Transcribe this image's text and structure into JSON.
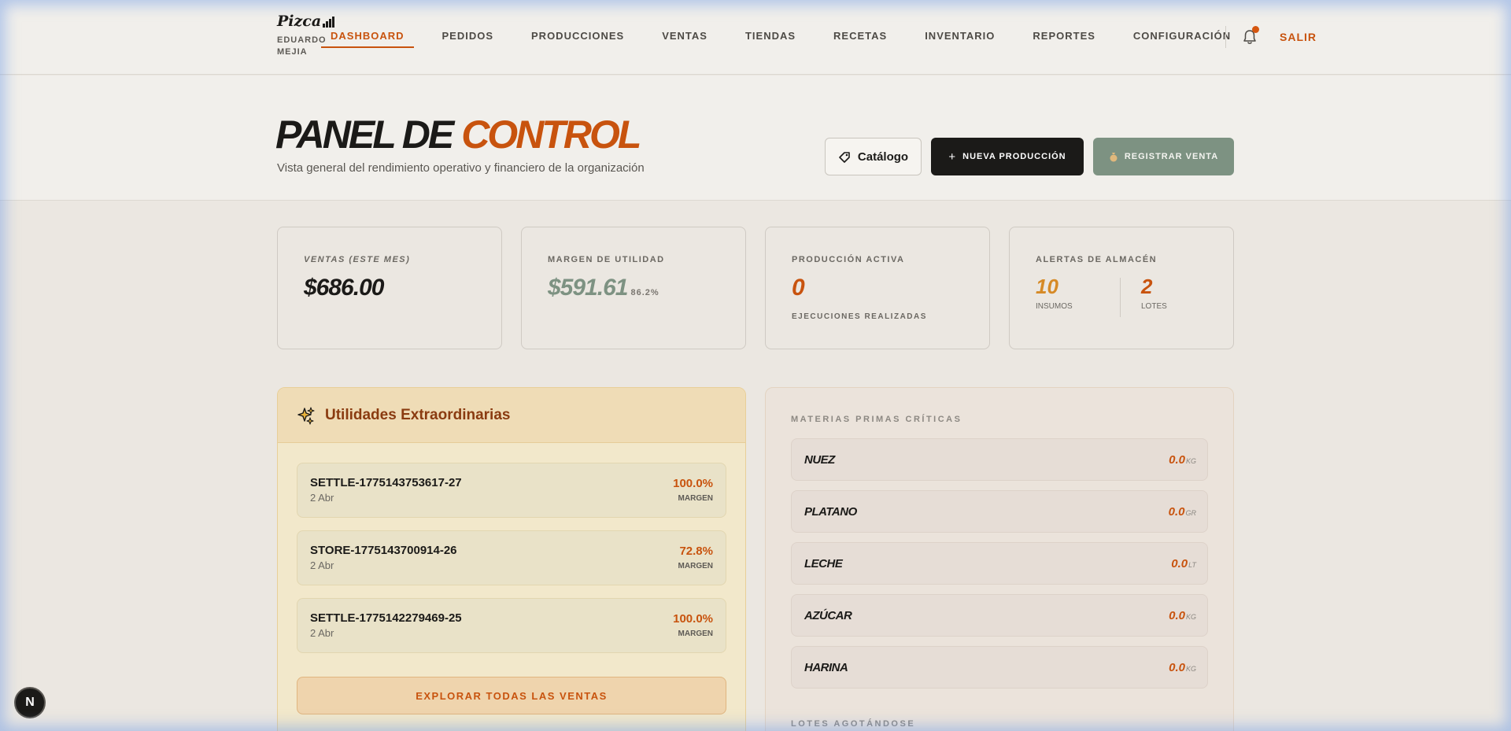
{
  "brand": {
    "logo_text": "Pizca",
    "user_name": "EDUARDO MEJIA"
  },
  "nav": {
    "items": [
      "DASHBOARD",
      "PEDIDOS",
      "PRODUCCIONES",
      "VENTAS",
      "TIENDAS",
      "RECETAS",
      "INVENTARIO",
      "REPORTES",
      "CONFIGURACIÓN"
    ],
    "active": "DASHBOARD",
    "logout_label": "SALIR"
  },
  "hero": {
    "title_part1": "PANEL DE",
    "title_part2": "CONTROL",
    "subtitle": "Vista general del rendimiento operativo y financiero de la organización",
    "catalog_label": "Catálogo",
    "new_production_label": "NUEVA PRODUCCIÓN",
    "register_sale_label": "REGISTRAR VENTA"
  },
  "kpis": {
    "sales": {
      "label": "VENTAS (ESTE MES)",
      "value": "$686.00"
    },
    "margin": {
      "label": "MARGEN DE UTILIDAD",
      "value": "$591.61",
      "percent": "86.2%"
    },
    "production": {
      "label": "PRODUCCIÓN ACTIVA",
      "value": "0",
      "caption": "EJECUCIONES REALIZADAS"
    },
    "alerts": {
      "label": "ALERTAS DE ALMACÉN",
      "supplies_value": "10",
      "supplies_caption": "INSUMOS",
      "lots_value": "2",
      "lots_caption": "LOTES"
    }
  },
  "extraordinary": {
    "title": "Utilidades Extraordinarias",
    "rows": [
      {
        "id": "SETTLE-1775143753617-27",
        "date": "2 Abr",
        "margin": "100.0%",
        "caption": "MARGEN"
      },
      {
        "id": "STORE-1775143700914-26",
        "date": "2 Abr",
        "margin": "72.8%",
        "caption": "MARGEN"
      },
      {
        "id": "SETTLE-1775142279469-25",
        "date": "2 Abr",
        "margin": "100.0%",
        "caption": "MARGEN"
      }
    ],
    "explore_label": "EXPLORAR TODAS LAS VENTAS"
  },
  "materials": {
    "title": "MATERIAS PRIMAS CRÍTICAS",
    "rows": [
      {
        "name": "NUEZ",
        "value": "0.0",
        "unit": "KG"
      },
      {
        "name": "PLATANO",
        "value": "0.0",
        "unit": "GR"
      },
      {
        "name": "LECHE",
        "value": "0.0",
        "unit": "LT"
      },
      {
        "name": "AZÚCAR",
        "value": "0.0",
        "unit": "KG"
      },
      {
        "name": "HARINA",
        "value": "0.0",
        "unit": "KG"
      }
    ],
    "lots_title": "LOTES AGOTÁNDOSE"
  },
  "dev_badge": "N",
  "colors": {
    "accent": "#c8530e",
    "dark": "#1b1a18",
    "sage": "#7d9282",
    "gold": "#d68a26"
  }
}
